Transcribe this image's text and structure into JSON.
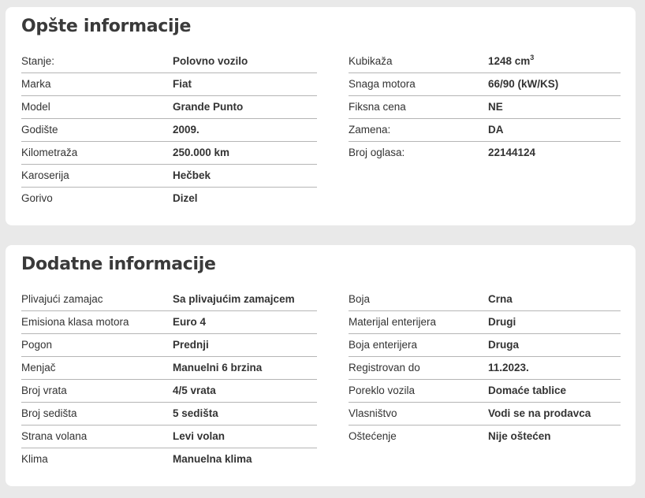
{
  "general": {
    "title": "Opšte informacije",
    "left": [
      {
        "label": "Stanje:",
        "value": "Polovno vozilo"
      },
      {
        "label": "Marka",
        "value": "Fiat"
      },
      {
        "label": "Model",
        "value": "Grande Punto"
      },
      {
        "label": "Godište",
        "value": "2009."
      },
      {
        "label": "Kilometraža",
        "value": "250.000 km"
      },
      {
        "label": "Karoserija",
        "value": "Hečbek"
      },
      {
        "label": "Gorivo",
        "value": "Dizel"
      }
    ],
    "right": [
      {
        "label": "Kubikaža",
        "value": "1248 cm",
        "sup": "3"
      },
      {
        "label": "Snaga motora",
        "value": "66/90 (kW/KS)"
      },
      {
        "label": "Fiksna cena",
        "value": "NE"
      },
      {
        "label": "Zamena:",
        "value": "DA"
      },
      {
        "label": "Broj oglasa:",
        "value": "22144124"
      }
    ]
  },
  "extra": {
    "title": "Dodatne informacije",
    "left": [
      {
        "label": "Plivajući zamajac",
        "value": "Sa plivajućim zamajcem"
      },
      {
        "label": "Emisiona klasa motora",
        "value": "Euro 4"
      },
      {
        "label": "Pogon",
        "value": "Prednji"
      },
      {
        "label": "Menjač",
        "value": "Manuelni 6 brzina"
      },
      {
        "label": "Broj vrata",
        "value": "4/5 vrata"
      },
      {
        "label": "Broj sedišta",
        "value": "5 sedišta"
      },
      {
        "label": "Strana volana",
        "value": "Levi volan"
      },
      {
        "label": "Klima",
        "value": "Manuelna klima"
      }
    ],
    "right": [
      {
        "label": "Boja",
        "value": "Crna"
      },
      {
        "label": "Materijal enterijera",
        "value": "Drugi"
      },
      {
        "label": "Boja enterijera",
        "value": "Druga"
      },
      {
        "label": "Registrovan do",
        "value": "11.2023."
      },
      {
        "label": "Poreklo vozila",
        "value": "Domaće tablice"
      },
      {
        "label": "Vlasništvo",
        "value": "Vodi se na prodavca"
      },
      {
        "label": "Oštećenje",
        "value": "Nije oštećen"
      }
    ]
  }
}
